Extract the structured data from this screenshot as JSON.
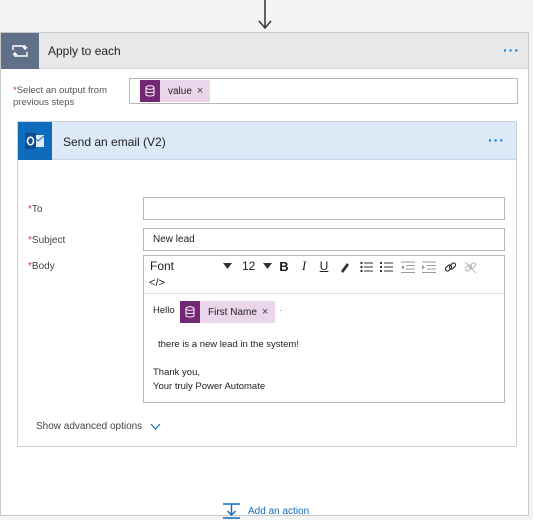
{
  "loop": {
    "title": "Apply to each",
    "more_label": "···",
    "select_label_req": "*",
    "select_label": "Select an output from previous steps",
    "token_value": "value",
    "token_remove": "×"
  },
  "email": {
    "title": "Send an email (V2)",
    "more_label": "···",
    "to_label": "To",
    "to_value": "",
    "subject_label": "Subject",
    "subject_value": "New lead",
    "body_label": "Body",
    "required_mark": "*",
    "toolbar": {
      "font": "Font",
      "size": "12",
      "bold": "B",
      "italic": "I",
      "underline": "U",
      "code": "</>"
    },
    "body": {
      "hello": "Hello",
      "token_first_name": "First Name",
      "token_remove": "×",
      "after_token": "·",
      "line1": "there is a new lead in the system!",
      "line2": "Thank you,",
      "line3": "Your truly Power Automate"
    },
    "advanced": "Show advanced options"
  },
  "add_action": "Add an action",
  "colors": {
    "loop_header_icon": "#607088",
    "token_purple": "#742774",
    "token_bg": "#ead5ea",
    "accent_blue": "#0f6cbd",
    "email_header_bg": "#dce9f7"
  },
  "icons": [
    "down-arrow-icon",
    "loop-icon",
    "database-icon",
    "outlook-icon",
    "chevron-down-icon",
    "insert-step-icon",
    "bold-icon",
    "italic-icon",
    "underline-icon",
    "highlight-icon",
    "bullet-list-icon",
    "numbered-list-icon",
    "outdent-icon",
    "indent-icon",
    "link-icon",
    "unlink-icon",
    "code-view-icon"
  ]
}
